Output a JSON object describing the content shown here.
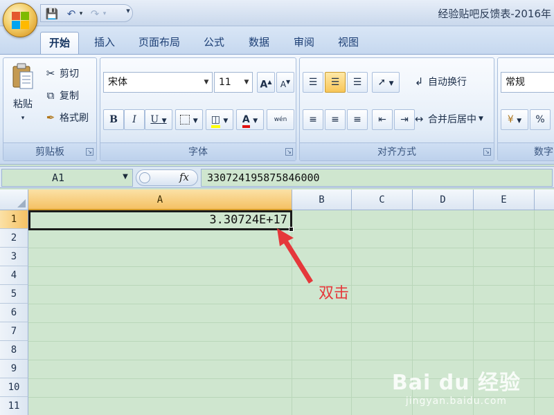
{
  "window": {
    "title": "经验贴吧反馈表-2016年"
  },
  "quick_access": {
    "save_icon": "save-icon",
    "undo_icon": "undo-icon",
    "redo_icon": "redo-icon"
  },
  "tabs": [
    "开始",
    "插入",
    "页面布局",
    "公式",
    "数据",
    "审阅",
    "视图"
  ],
  "ribbon": {
    "clipboard": {
      "label": "剪贴板",
      "paste": "粘贴",
      "cut": "剪切",
      "copy": "复制",
      "format_painter": "格式刷"
    },
    "font": {
      "label": "字体",
      "font_name": "宋体",
      "font_size": "11",
      "bold": "B",
      "italic": "I",
      "underline": "U",
      "grow": "A",
      "shrink": "A",
      "font_color_letter": "A",
      "phonetic": "wén"
    },
    "alignment": {
      "label": "对齐方式",
      "wrap_text": "自动换行",
      "merge_center": "合并后居中"
    },
    "number": {
      "label": "数字",
      "format": "常规",
      "percent": "%"
    }
  },
  "formula_bar": {
    "name_box": "A1",
    "fx_label": "fx",
    "content": "330724195875846000"
  },
  "grid": {
    "columns": [
      "A",
      "B",
      "C",
      "D",
      "E"
    ],
    "rows": [
      "1",
      "2",
      "3",
      "4",
      "5",
      "6",
      "7",
      "8",
      "9",
      "10",
      "11"
    ],
    "active_cell_value": "3.30724E+17"
  },
  "annotation": {
    "text": "双击",
    "color": "#e5383b"
  },
  "watermark": {
    "logo": "Bai du 经验",
    "url": "jingyan.baidu.com"
  },
  "colors": {
    "sheet_background": "#cfe6cf",
    "selected_header": "#f5c164",
    "ribbon": "#dce8f6"
  }
}
